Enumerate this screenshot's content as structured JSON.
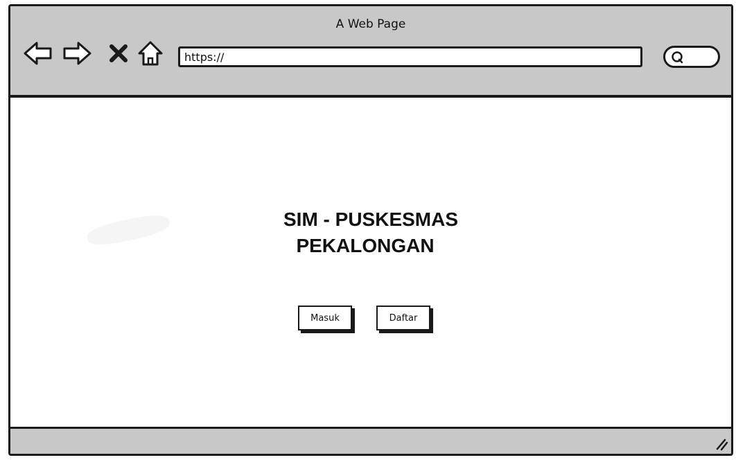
{
  "window": {
    "title": "A Web Page"
  },
  "toolbar": {
    "back_icon": "back-arrow-icon",
    "forward_icon": "forward-arrow-icon",
    "stop_icon": "close-icon",
    "home_icon": "home-icon",
    "search_icon": "search-icon"
  },
  "address": {
    "value": "https://"
  },
  "main": {
    "title_line1": "SIM - PUSKESMAS",
    "title_line2": "PEKALONGAN",
    "buttons": {
      "login_label": "Masuk",
      "register_label": "Daftar"
    }
  },
  "colors": {
    "chrome": "#c8c8c8",
    "outline": "#1a1a1a",
    "background": "#ffffff"
  }
}
